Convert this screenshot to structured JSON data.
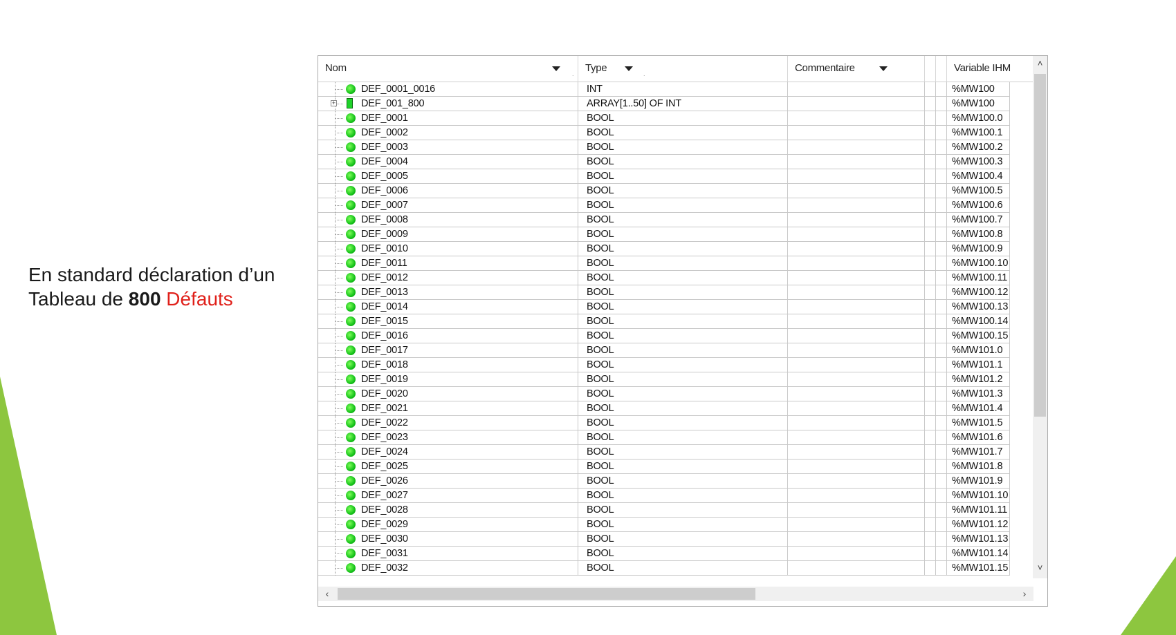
{
  "caption": {
    "line1": "En standard déclaration d’un",
    "line2_prefix": "Tableau de ",
    "line2_bold": "800",
    "line2_red": "Défauts"
  },
  "colors": {
    "accent_green": "#8dc63f",
    "highlight_red": "#e0201a"
  },
  "table": {
    "columns": [
      "Nom",
      "Type",
      "Commentaire",
      "Variable IHM"
    ],
    "rows": [
      {
        "name": "DEF_0001_0016",
        "type": "INT",
        "comment": "",
        "hmi": "%MW100",
        "icon": "variable-icon"
      },
      {
        "name": "DEF_001_800",
        "type": "ARRAY[1..50] OF INT",
        "comment": "",
        "hmi": "%MW100",
        "icon": "array-icon",
        "expandable": true
      },
      {
        "name": "DEF_0001",
        "type": "BOOL",
        "comment": "",
        "hmi": "%MW100.0",
        "icon": "variable-icon"
      },
      {
        "name": "DEF_0002",
        "type": "BOOL",
        "comment": "",
        "hmi": "%MW100.1",
        "icon": "variable-icon"
      },
      {
        "name": "DEF_0003",
        "type": "BOOL",
        "comment": "",
        "hmi": "%MW100.2",
        "icon": "variable-icon"
      },
      {
        "name": "DEF_0004",
        "type": "BOOL",
        "comment": "",
        "hmi": "%MW100.3",
        "icon": "variable-icon"
      },
      {
        "name": "DEF_0005",
        "type": "BOOL",
        "comment": "",
        "hmi": "%MW100.4",
        "icon": "variable-icon"
      },
      {
        "name": "DEF_0006",
        "type": "BOOL",
        "comment": "",
        "hmi": "%MW100.5",
        "icon": "variable-icon"
      },
      {
        "name": "DEF_0007",
        "type": "BOOL",
        "comment": "",
        "hmi": "%MW100.6",
        "icon": "variable-icon"
      },
      {
        "name": "DEF_0008",
        "type": "BOOL",
        "comment": "",
        "hmi": "%MW100.7",
        "icon": "variable-icon"
      },
      {
        "name": "DEF_0009",
        "type": "BOOL",
        "comment": "",
        "hmi": "%MW100.8",
        "icon": "variable-icon"
      },
      {
        "name": "DEF_0010",
        "type": "BOOL",
        "comment": "",
        "hmi": "%MW100.9",
        "icon": "variable-icon"
      },
      {
        "name": "DEF_0011",
        "type": "BOOL",
        "comment": "",
        "hmi": "%MW100.10",
        "icon": "variable-icon"
      },
      {
        "name": "DEF_0012",
        "type": "BOOL",
        "comment": "",
        "hmi": "%MW100.11",
        "icon": "variable-icon"
      },
      {
        "name": "DEF_0013",
        "type": "BOOL",
        "comment": "",
        "hmi": "%MW100.12",
        "icon": "variable-icon"
      },
      {
        "name": "DEF_0014",
        "type": "BOOL",
        "comment": "",
        "hmi": "%MW100.13",
        "icon": "variable-icon"
      },
      {
        "name": "DEF_0015",
        "type": "BOOL",
        "comment": "",
        "hmi": "%MW100.14",
        "icon": "variable-icon"
      },
      {
        "name": "DEF_0016",
        "type": "BOOL",
        "comment": "",
        "hmi": "%MW100.15",
        "icon": "variable-icon"
      },
      {
        "name": "DEF_0017",
        "type": "BOOL",
        "comment": "",
        "hmi": "%MW101.0",
        "icon": "variable-icon"
      },
      {
        "name": "DEF_0018",
        "type": "BOOL",
        "comment": "",
        "hmi": "%MW101.1",
        "icon": "variable-icon"
      },
      {
        "name": "DEF_0019",
        "type": "BOOL",
        "comment": "",
        "hmi": "%MW101.2",
        "icon": "variable-icon"
      },
      {
        "name": "DEF_0020",
        "type": "BOOL",
        "comment": "",
        "hmi": "%MW101.3",
        "icon": "variable-icon"
      },
      {
        "name": "DEF_0021",
        "type": "BOOL",
        "comment": "",
        "hmi": "%MW101.4",
        "icon": "variable-icon"
      },
      {
        "name": "DEF_0022",
        "type": "BOOL",
        "comment": "",
        "hmi": "%MW101.5",
        "icon": "variable-icon"
      },
      {
        "name": "DEF_0023",
        "type": "BOOL",
        "comment": "",
        "hmi": "%MW101.6",
        "icon": "variable-icon"
      },
      {
        "name": "DEF_0024",
        "type": "BOOL",
        "comment": "",
        "hmi": "%MW101.7",
        "icon": "variable-icon"
      },
      {
        "name": "DEF_0025",
        "type": "BOOL",
        "comment": "",
        "hmi": "%MW101.8",
        "icon": "variable-icon"
      },
      {
        "name": "DEF_0026",
        "type": "BOOL",
        "comment": "",
        "hmi": "%MW101.9",
        "icon": "variable-icon"
      },
      {
        "name": "DEF_0027",
        "type": "BOOL",
        "comment": "",
        "hmi": "%MW101.10",
        "icon": "variable-icon"
      },
      {
        "name": "DEF_0028",
        "type": "BOOL",
        "comment": "",
        "hmi": "%MW101.11",
        "icon": "variable-icon"
      },
      {
        "name": "DEF_0029",
        "type": "BOOL",
        "comment": "",
        "hmi": "%MW101.12",
        "icon": "variable-icon"
      },
      {
        "name": "DEF_0030",
        "type": "BOOL",
        "comment": "",
        "hmi": "%MW101.13",
        "icon": "variable-icon"
      },
      {
        "name": "DEF_0031",
        "type": "BOOL",
        "comment": "",
        "hmi": "%MW101.14",
        "icon": "variable-icon"
      },
      {
        "name": "DEF_0032",
        "type": "BOOL",
        "comment": "",
        "hmi": "%MW101.15",
        "icon": "variable-icon"
      }
    ]
  },
  "scrollbars": {
    "vertical_up_icon": "chevron-up-icon",
    "vertical_down_icon": "chevron-down-icon",
    "horizontal_left_icon": "chevron-left-icon",
    "horizontal_right_icon": "chevron-right-icon"
  }
}
